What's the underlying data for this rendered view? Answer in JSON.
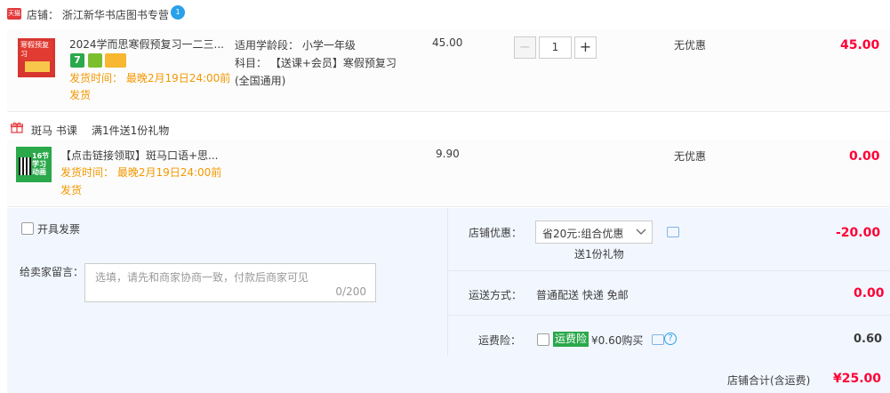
{
  "shop": {
    "badge": "天猫",
    "label": "店铺： 浙江新华书店图书专营",
    "ww_icon": "chat-icon",
    "ww_badge": "1"
  },
  "item1": {
    "title": "2024学而思寒假预复习一二三...",
    "thumb_text": "寒假预复习",
    "tags": [
      "7",
      "",
      "",
      ""
    ],
    "ship_line1": "发货时间： 最晚2月19日24:00前",
    "ship_line2": "发货",
    "attr1": "适用学龄段： 小学一年级",
    "attr2": "科目： 【送课+会员】寒假预复习",
    "attr3": "(全国通用)",
    "unit_price": "45.00",
    "minus": "−",
    "qty": "1",
    "plus": "+",
    "discount": "无优惠",
    "subtotal": "45.00"
  },
  "gift_row": {
    "label": "斑马 书课",
    "promo": "满1件送1份礼物"
  },
  "item2": {
    "title": "【点击链接领取】斑马口语+思...",
    "thumb_text": "16节学习动画",
    "ship_line1": "发货时间： 最晚2月19日24:00前",
    "ship_line2": "发货",
    "unit_price": "9.90",
    "discount": "无优惠",
    "subtotal": "0.00"
  },
  "order": {
    "invoice_label": "开具发票",
    "message_label": "给卖家留言：",
    "message_placeholder": "选填，请先和商家协商一致，付款后商家可见",
    "message_count": "0/200",
    "shop_discount_label": "店铺优惠：",
    "shop_discount_selected": "省20元:组合优惠",
    "gift_note": "送1份礼物",
    "shop_discount_amount": "-20.00",
    "shipping_label": "运送方式：",
    "shipping_value": "普通配送 快递 免邮",
    "shipping_amount": "0.00",
    "insurance_label": "运费险：",
    "insurance_tag": "运费险",
    "insurance_text": "¥0.60购买",
    "insurance_amount": "0.60"
  },
  "total": {
    "label": "店铺合计(含运费)",
    "amount": "¥25.00"
  },
  "colors": {
    "accent_red": "#ff0036",
    "ship_orange": "#f39800",
    "panel_blue": "#f2f7ff",
    "green": "#2aa84a"
  }
}
